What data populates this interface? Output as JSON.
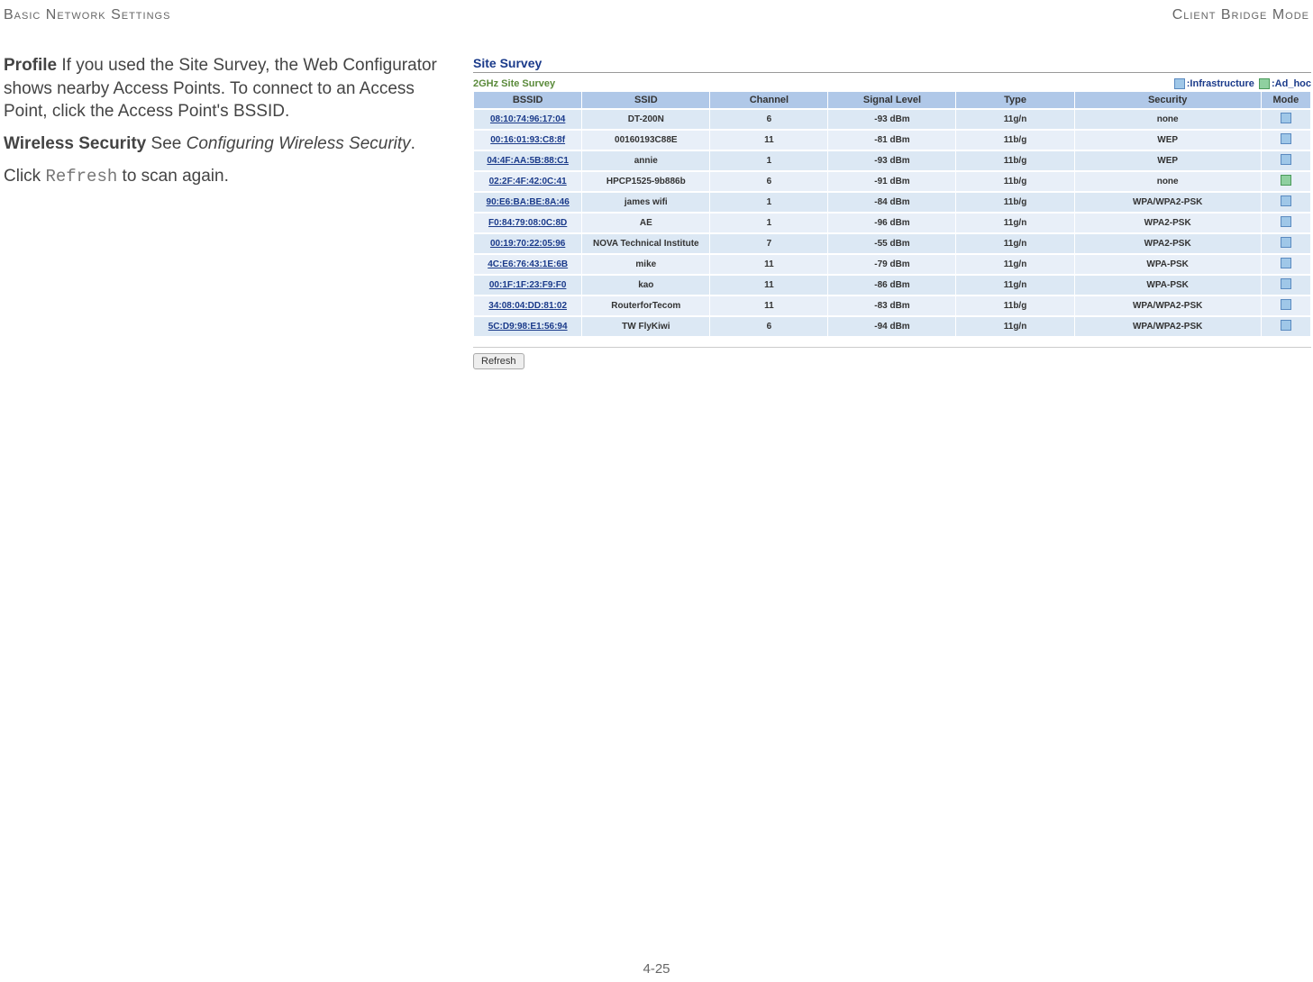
{
  "header": {
    "left": "Basic Network Settings",
    "right": "Client Bridge Mode"
  },
  "left_text": {
    "profile_label": "Profile",
    "profile_body": "  If you used the Site Survey, the Web Configurator shows nearby Access Points. To connect to an Access Point, click the Access Point's BSSID.",
    "wsec_label": "Wireless Security",
    "wsec_see": "  See ",
    "wsec_italic": "Configuring Wireless Security",
    "wsec_period": ".",
    "click_word": "Click ",
    "refresh_mono": "Refresh",
    "scan_again": " to scan again."
  },
  "panel": {
    "title": "Site Survey",
    "subtitle": "2GHz Site Survey",
    "legend_infra": ":Infrastructure",
    "legend_adhoc": ":Ad_hoc",
    "refresh_label": "Refresh",
    "columns": {
      "bssid": "BSSID",
      "ssid": "SSID",
      "channel": "Channel",
      "signal": "Signal Level",
      "type": "Type",
      "security": "Security",
      "mode": "Mode"
    },
    "rows": [
      {
        "bssid": "08:10:74:96:17:04",
        "ssid": "DT-200N",
        "channel": "6",
        "signal": "-93 dBm",
        "type": "11g/n",
        "security": "none",
        "mode": "infra"
      },
      {
        "bssid": "00:16:01:93:C8:8f",
        "ssid": "00160193C88E",
        "channel": "11",
        "signal": "-81 dBm",
        "type": "11b/g",
        "security": "WEP",
        "mode": "infra"
      },
      {
        "bssid": "04:4F:AA:5B:88:C1",
        "ssid": "annie",
        "channel": "1",
        "signal": "-93 dBm",
        "type": "11b/g",
        "security": "WEP",
        "mode": "infra"
      },
      {
        "bssid": "02:2F:4F:42:0C:41",
        "ssid": "HPCP1525-9b886b",
        "channel": "6",
        "signal": "-91 dBm",
        "type": "11b/g",
        "security": "none",
        "mode": "adhoc"
      },
      {
        "bssid": "90:E6:BA:BE:8A:46",
        "ssid": "james wifi",
        "channel": "1",
        "signal": "-84 dBm",
        "type": "11b/g",
        "security": "WPA/WPA2-PSK",
        "mode": "infra"
      },
      {
        "bssid": "F0:84:79:08:0C:8D",
        "ssid": "AE",
        "channel": "1",
        "signal": "-96 dBm",
        "type": "11g/n",
        "security": "WPA2-PSK",
        "mode": "infra"
      },
      {
        "bssid": "00:19:70:22:05:96",
        "ssid": "NOVA Technical Institute",
        "channel": "7",
        "signal": "-55 dBm",
        "type": "11g/n",
        "security": "WPA2-PSK",
        "mode": "infra"
      },
      {
        "bssid": "4C:E6:76:43:1E:6B",
        "ssid": "mike",
        "channel": "11",
        "signal": "-79 dBm",
        "type": "11g/n",
        "security": "WPA-PSK",
        "mode": "infra"
      },
      {
        "bssid": "00:1F:1F:23:F9:F0",
        "ssid": "kao",
        "channel": "11",
        "signal": "-86 dBm",
        "type": "11g/n",
        "security": "WPA-PSK",
        "mode": "infra"
      },
      {
        "bssid": "34:08:04:DD:81:02",
        "ssid": "RouterforTecom",
        "channel": "11",
        "signal": "-83 dBm",
        "type": "11b/g",
        "security": "WPA/WPA2-PSK",
        "mode": "infra"
      },
      {
        "bssid": "5C:D9:98:E1:56:94",
        "ssid": "TW FlyKiwi",
        "channel": "6",
        "signal": "-94 dBm",
        "type": "11g/n",
        "security": "WPA/WPA2-PSK",
        "mode": "infra"
      }
    ]
  },
  "footer": {
    "page": "4-25"
  }
}
